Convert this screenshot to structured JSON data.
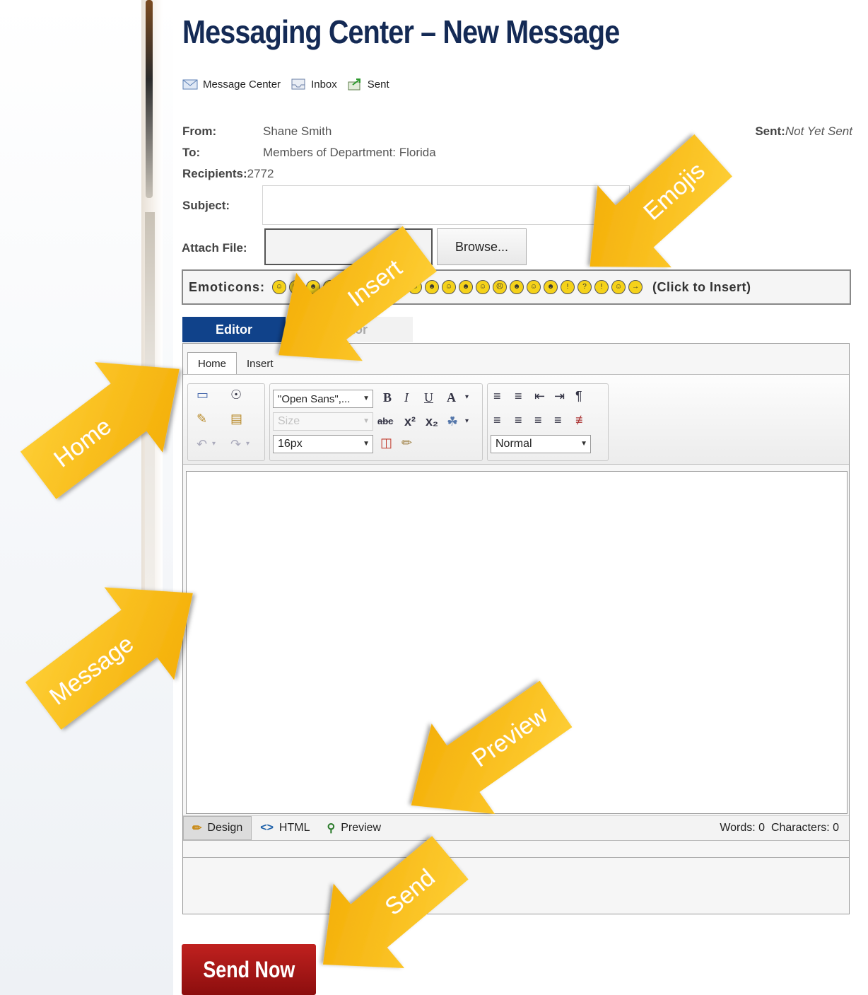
{
  "page": {
    "title": "Messaging Center – New Message"
  },
  "nav": {
    "items": [
      {
        "label": "Message Center",
        "icon": "envelope-icon"
      },
      {
        "label": "Inbox",
        "icon": "inbox-icon"
      },
      {
        "label": "Sent",
        "icon": "sent-icon"
      }
    ]
  },
  "message": {
    "from_label": "From:",
    "from_value": "Shane Smith",
    "to_label": "To:",
    "to_value": "Members of Department: Florida",
    "recipients_label": "Recipients:",
    "recipients_value": "2772",
    "sent_label": "Sent:",
    "sent_value": "Not Yet Sent",
    "subject_label": "Subject:",
    "subject_value": "",
    "attach_label": "Attach File:",
    "browse_label": "Browse..."
  },
  "emoticons": {
    "label": "Emoticons:",
    "hint": "(Click to Insert)",
    "count": 22
  },
  "mode_tabs": {
    "editor": "Editor",
    "other": "Editor"
  },
  "ribbon": {
    "tabs": [
      "Home",
      "Insert"
    ],
    "font_family": "\"Open Sans\",...",
    "font_size_placeholder": "Size",
    "font_size_px": "16px",
    "paragraph_format": "Normal"
  },
  "bottom_bar": {
    "design": "Design",
    "html": "HTML",
    "preview": "Preview",
    "words": "Words: 0",
    "characters": "Characters: 0"
  },
  "send": {
    "label": "Send Now"
  },
  "annotations": {
    "home": "Home",
    "insert": "Insert",
    "emojis": "Emojis",
    "message": "Message",
    "preview": "Preview",
    "send": "Send",
    "arrow_color": "#f5b90a"
  }
}
